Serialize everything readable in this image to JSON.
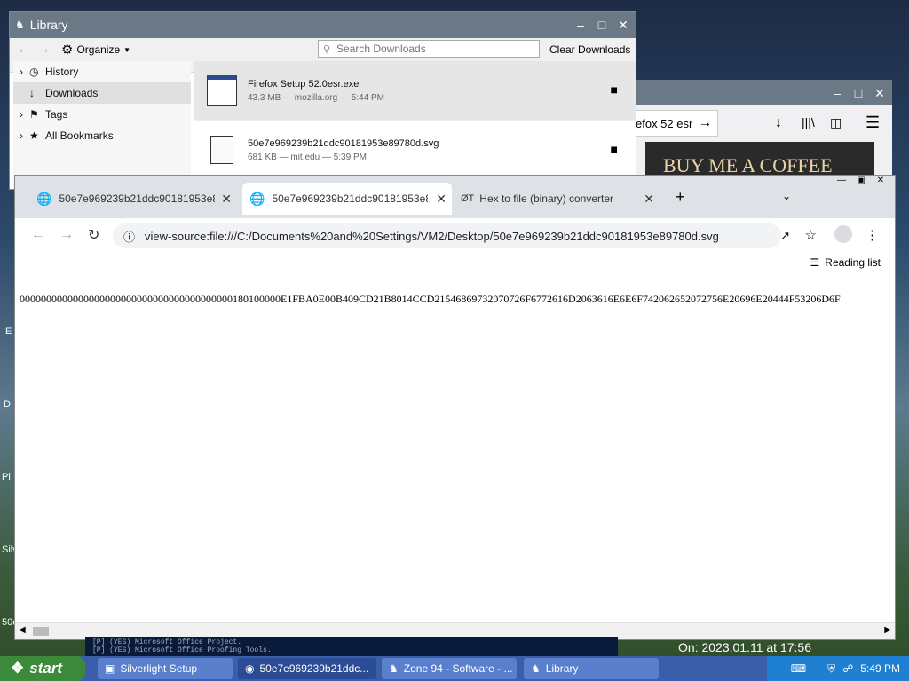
{
  "desktop": {
    "labels": [
      "E",
      "D",
      "Pi",
      "Silv",
      "50e"
    ]
  },
  "library": {
    "title": "Library",
    "toolbar": {
      "organize": "Organize",
      "search_placeholder": "Search Downloads",
      "clear": "Clear Downloads"
    },
    "sidebar": [
      "History",
      "Downloads",
      "Tags",
      "All Bookmarks"
    ],
    "downloads": [
      {
        "name": "Firefox Setup 52.0esr.exe",
        "meta": "43.3 MB — mozilla.org — 5:44 PM"
      },
      {
        "name": "50e7e969239b21ddc90181953e89780d.svg",
        "meta": "681 KB — mit.edu — 5:39 PM"
      }
    ]
  },
  "firefox": {
    "urlbar_text": "efox 52 esr",
    "banner": "BUY ME A COFFEE"
  },
  "chrome": {
    "tabs": [
      {
        "label": "50e7e969239b21ddc90181953e897"
      },
      {
        "label": "50e7e969239b21ddc90181953e897"
      },
      {
        "label": "Hex to file (binary) converter",
        "favicon": "ØT"
      }
    ],
    "url": "view-source:file:///C:/Documents%20and%20Settings/VM2/Desktop/50e7e969239b21ddc90181953e89780d.svg",
    "reading_list": "Reading list",
    "content_text": "0000000000000000000000000000000000000000180100000E1FBA0E00B409CD21B8014CCD21546869732070726F6772616D2063616E6E6F742062652072756E20696E20444F53206D6F"
  },
  "console": {
    "lines": [
      "[P] (YES) Microsoft Office Project.",
      "[P] (YES) Microsoft Office Proofing Tools."
    ]
  },
  "status_text": "On: 2023.01.11 at 17:56",
  "taskbar": {
    "start": "start",
    "items": [
      "Silverlight Setup",
      "50e7e969239b21ddc...",
      "Zone 94 - Software - ...",
      "Library"
    ],
    "clock": "5:49 PM"
  },
  "colors": {
    "xp_blue": "#3a5ea8",
    "start_green": "#3a8a3a",
    "chrome_tabstrip": "#dee1e6"
  }
}
